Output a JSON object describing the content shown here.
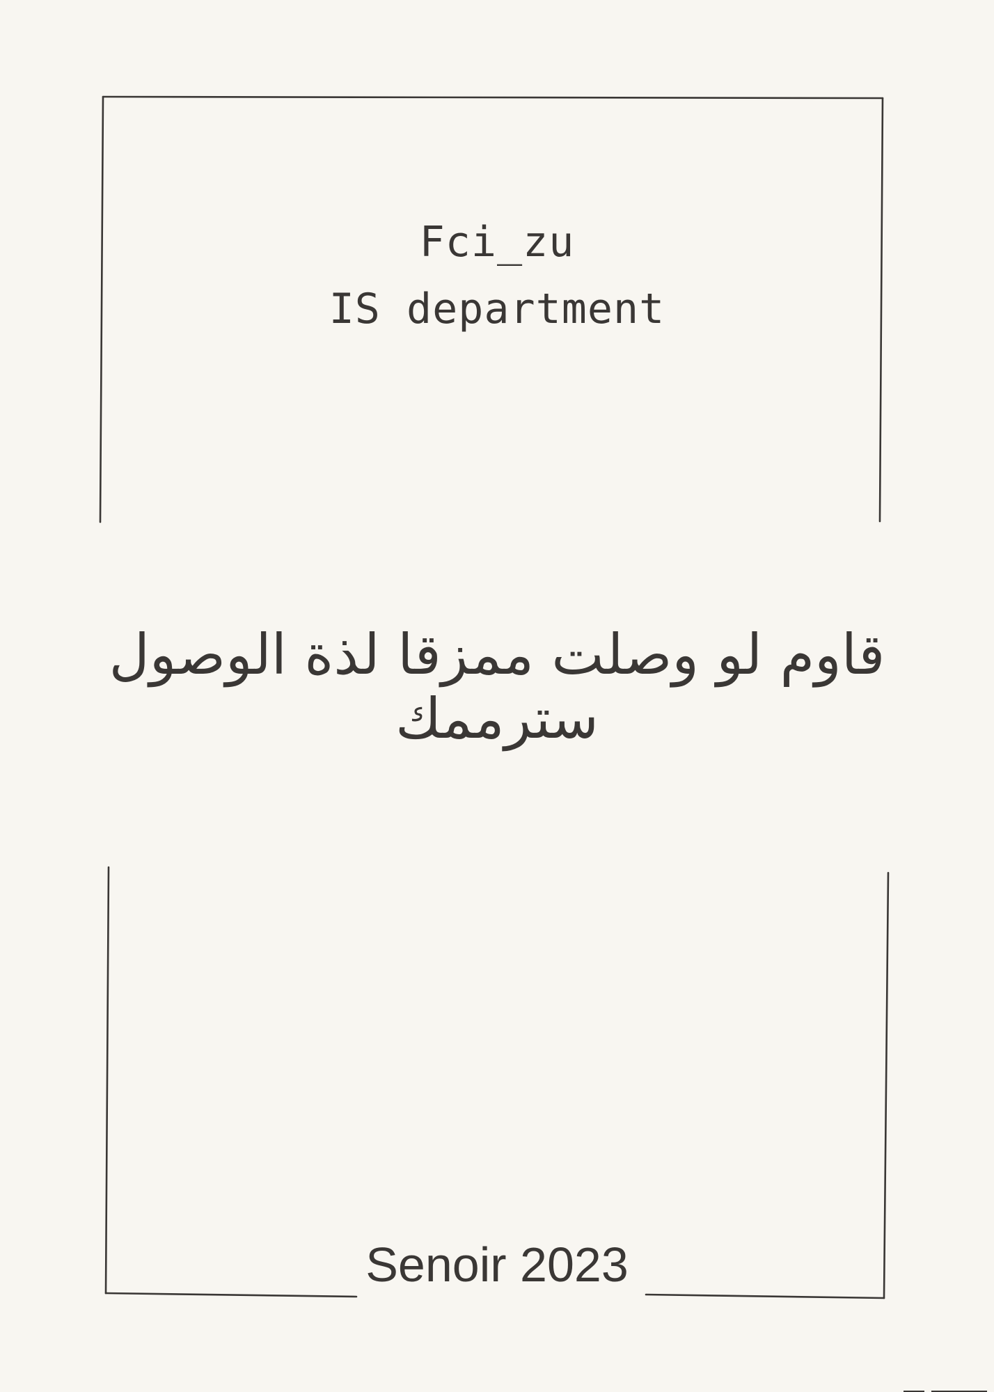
{
  "header": {
    "line1": "Fci_zu",
    "line2": "IS department"
  },
  "quote": {
    "text": "قاوم لو وصلت ممزقا لذة الوصول سترممك"
  },
  "footer": {
    "text": "Senoir 2023"
  },
  "colors": {
    "background": "#f8f6f1",
    "ink": "#3a3735"
  }
}
